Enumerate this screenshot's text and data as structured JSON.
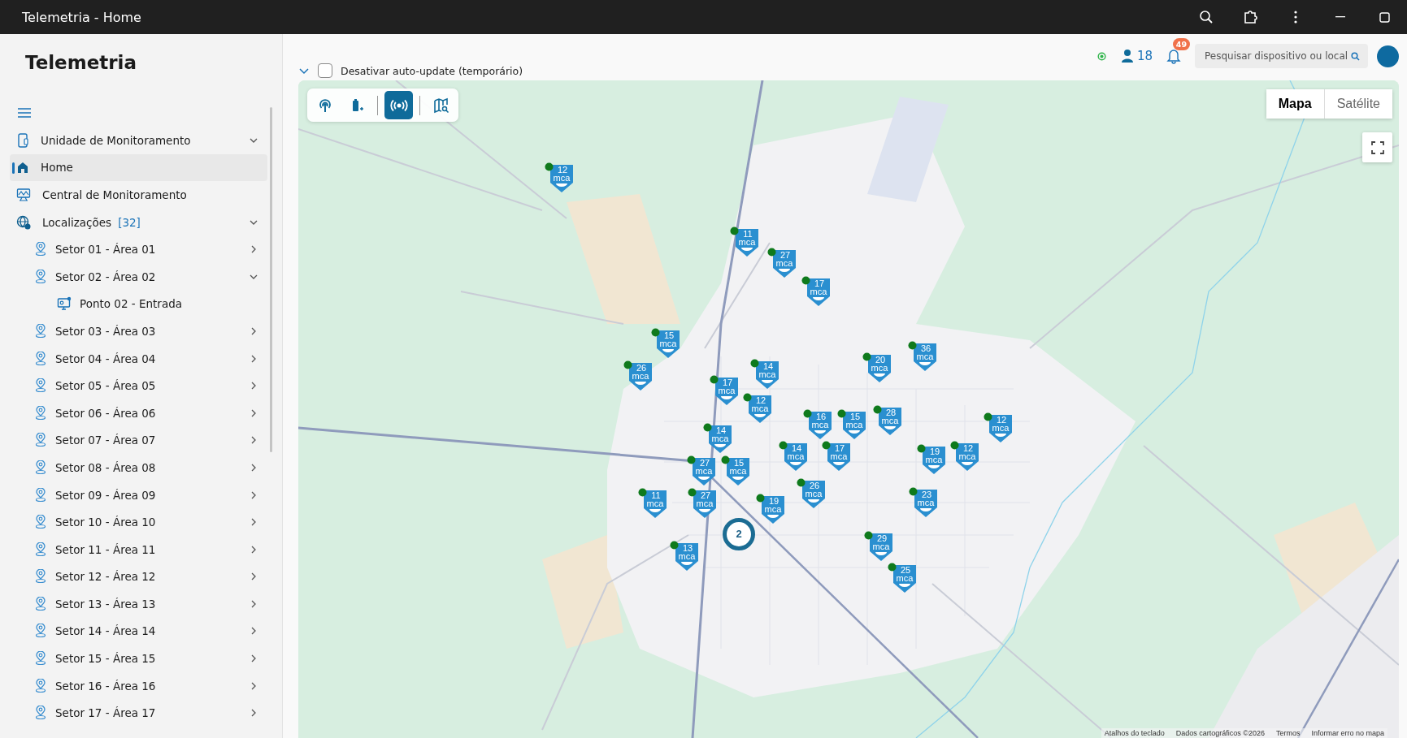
{
  "window": {
    "title": "Telemetria - Home"
  },
  "sidebar": {
    "title": "Telemetria",
    "items": [
      {
        "label": "Unidade de Monitoramento",
        "selected": false
      },
      {
        "label": "Home",
        "selected": true
      },
      {
        "label": "Central de Monitoramento",
        "selected": false
      },
      {
        "label": "Localizações",
        "badge": "[32]",
        "selected": false,
        "children": [
          {
            "label": "Setor 01 - Área 01",
            "expanded": false
          },
          {
            "label": "Setor 02 - Área 02",
            "expanded": true,
            "children": [
              {
                "label": "Ponto 02 - Entrada"
              }
            ]
          },
          {
            "label": "Setor 03 - Área 03",
            "expanded": false
          },
          {
            "label": "Setor 04 - Área 04",
            "expanded": false
          },
          {
            "label": "Setor 05 - Área 05",
            "expanded": false
          },
          {
            "label": "Setor 06 - Área 06",
            "expanded": false
          },
          {
            "label": "Setor 07 - Área 07",
            "expanded": false
          },
          {
            "label": "Setor 08 - Área 08",
            "expanded": false
          },
          {
            "label": "Setor 09 - Área 09",
            "expanded": false
          },
          {
            "label": "Setor 10 - Área 10",
            "expanded": false
          },
          {
            "label": "Setor 11 - Área 11",
            "expanded": false
          },
          {
            "label": "Setor 12 - Área 12",
            "expanded": false
          },
          {
            "label": "Setor 13 - Área 13",
            "expanded": false
          },
          {
            "label": "Setor 14 - Área 14",
            "expanded": false
          },
          {
            "label": "Setor 15 - Área 15",
            "expanded": false
          },
          {
            "label": "Setor 16 - Área 16",
            "expanded": false
          },
          {
            "label": "Setor 17 - Área 17",
            "expanded": false
          }
        ]
      }
    ]
  },
  "auto_update": {
    "label": "Desativar auto-update (temporário)",
    "checked": false
  },
  "header": {
    "online_users": "18",
    "notifications": "49",
    "search": {
      "placeholder": "Pesquisar dispositivo ou local"
    }
  },
  "map": {
    "toolbar": [
      {
        "selected": false
      },
      {
        "selected": false
      },
      {
        "selected": true
      },
      {
        "selected": false
      }
    ],
    "map_types": [
      {
        "label": "Mapa",
        "selected": true
      },
      {
        "label": "Satélite",
        "selected": false
      }
    ],
    "pins": [
      {
        "value": "12",
        "unit": "mca"
      },
      {
        "value": "11",
        "unit": "mca"
      },
      {
        "value": "27",
        "unit": "mca"
      },
      {
        "value": "17",
        "unit": "mca"
      },
      {
        "value": "15",
        "unit": "mca"
      },
      {
        "value": "26",
        "unit": "mca"
      },
      {
        "value": "14",
        "unit": "mca"
      },
      {
        "value": "20",
        "unit": "mca"
      },
      {
        "value": "36",
        "unit": "mca"
      },
      {
        "value": "17",
        "unit": "mca"
      },
      {
        "value": "12",
        "unit": "mca"
      },
      {
        "value": "16",
        "unit": "mca"
      },
      {
        "value": "15",
        "unit": "mca"
      },
      {
        "value": "28",
        "unit": "mca"
      },
      {
        "value": "17",
        "unit": "mca"
      },
      {
        "value": "14",
        "unit": "mca"
      },
      {
        "value": "14",
        "unit": "mca"
      },
      {
        "value": "27",
        "unit": "mca"
      },
      {
        "value": "15",
        "unit": "mca"
      },
      {
        "value": "12",
        "unit": "mca"
      },
      {
        "value": "19",
        "unit": "mca"
      },
      {
        "value": "12",
        "unit": "mca"
      },
      {
        "value": "11",
        "unit": "mca"
      },
      {
        "value": "27",
        "unit": "mca"
      },
      {
        "value": "19",
        "unit": "mca"
      },
      {
        "value": "26",
        "unit": "mca"
      },
      {
        "value": "23",
        "unit": "mca"
      },
      {
        "value": "13",
        "unit": "mca"
      },
      {
        "value": "29",
        "unit": "mca"
      },
      {
        "value": "25",
        "unit": "mca"
      }
    ],
    "cluster": "2",
    "attribution": [
      "Atalhos do teclado",
      "Dados cartográficos ©2026",
      "Termos",
      "Informar erro no mapa"
    ]
  }
}
